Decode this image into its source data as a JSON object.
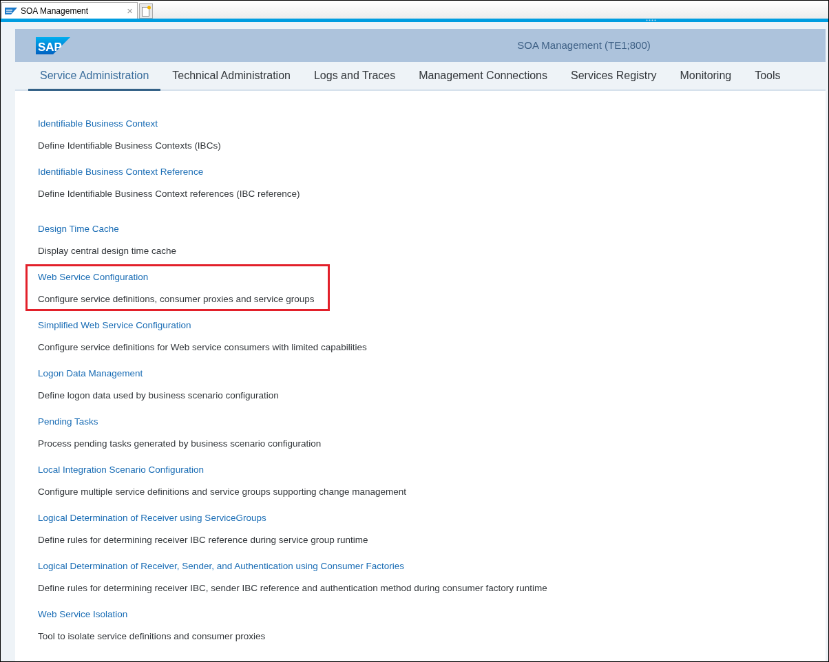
{
  "browser_tab": {
    "title": "SOA Management",
    "close": "×"
  },
  "header": {
    "logo_text": "SAP",
    "title": "SOA Management (TE1;800)"
  },
  "tabs": [
    {
      "label": "Service Administration",
      "selected": true
    },
    {
      "label": "Technical Administration",
      "selected": false
    },
    {
      "label": "Logs and Traces",
      "selected": false
    },
    {
      "label": "Management Connections",
      "selected": false
    },
    {
      "label": "Services Registry",
      "selected": false
    },
    {
      "label": "Monitoring",
      "selected": false
    },
    {
      "label": "Tools",
      "selected": false
    }
  ],
  "sections": [
    {
      "items": [
        {
          "link": "Identifiable Business Context",
          "description": "Define Identifiable Business Contexts (IBCs)",
          "highlighted": false
        },
        {
          "link": "Identifiable Business Context Reference",
          "description": "Define Identifiable Business Context references (IBC reference)",
          "highlighted": false
        }
      ]
    },
    {
      "items": [
        {
          "link": "Design Time Cache",
          "description": "Display central design time cache",
          "highlighted": false
        },
        {
          "link": "Web Service Configuration",
          "description": "Configure service definitions, consumer proxies and service groups",
          "highlighted": true
        },
        {
          "link": "Simplified Web Service Configuration",
          "description": "Configure service definitions for Web service consumers with limited capabilities",
          "highlighted": false
        },
        {
          "link": "Logon Data Management",
          "description": "Define logon data used by business scenario configuration",
          "highlighted": false
        },
        {
          "link": "Pending Tasks",
          "description": "Process pending tasks generated by business scenario configuration",
          "highlighted": false
        },
        {
          "link": "Local Integration Scenario Configuration",
          "description": "Configure multiple service definitions and service groups supporting change management",
          "highlighted": false
        },
        {
          "link": "Logical Determination of Receiver using ServiceGroups",
          "description": "Define rules for determining receiver IBC reference during service group runtime",
          "highlighted": false
        },
        {
          "link": "Logical Determination of Receiver, Sender, and Authentication using Consumer Factories",
          "description": "Define rules for determining receiver IBC, sender IBC reference and authentication method during consumer factory runtime",
          "highlighted": false
        },
        {
          "link": "Web Service Isolation",
          "description": "Tool to isolate service definitions and consumer proxies",
          "highlighted": false
        }
      ]
    }
  ]
}
